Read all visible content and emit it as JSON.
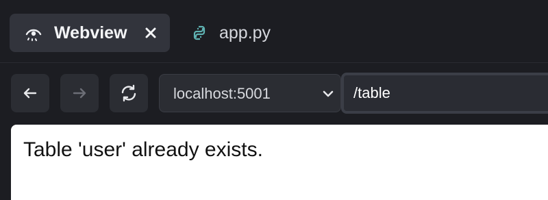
{
  "tabs": [
    {
      "label": "Webview",
      "icon": "webview-eye-icon",
      "active": true,
      "close_icon": "close-icon"
    },
    {
      "label": "app.py",
      "icon": "python-icon",
      "active": false
    }
  ],
  "toolbar": {
    "back_icon": "arrow-left-icon",
    "forward_icon": "arrow-right-icon",
    "reload_icon": "refresh-icon",
    "host": "localhost:5001",
    "host_dropdown_icon": "chevron-down-icon",
    "path": "/table"
  },
  "page": {
    "message": "Table 'user' already exists."
  },
  "colors": {
    "background": "#1c1d22",
    "tab_active": "#32343c",
    "button": "#2b2d33",
    "python_icon": "#5fb3b3"
  }
}
